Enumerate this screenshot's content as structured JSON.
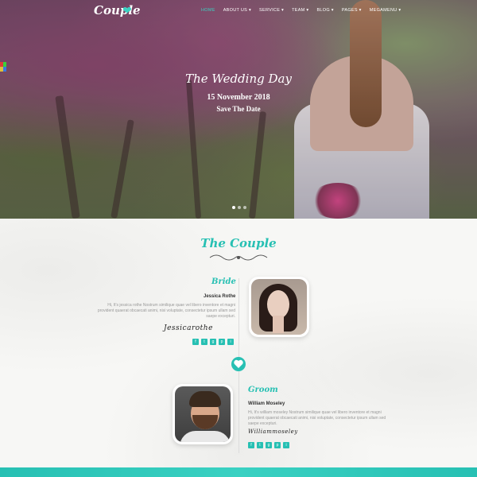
{
  "site": {
    "logo": "Couple"
  },
  "nav": {
    "items": [
      "HOME",
      "ABOUT US ▾",
      "SERVICE ▾",
      "TEAM ▾",
      "BLOG ▾",
      "PAGES ▾",
      "MEGAMENU ▾"
    ],
    "active_index": 0
  },
  "hero": {
    "title": "The Wedding Day",
    "date": "15 November 2018",
    "tagline": "Save The Date",
    "slides": 3,
    "active_slide": 0
  },
  "couple": {
    "section_title": "The Couple",
    "bride": {
      "role": "Bride",
      "name": "Jessica Rothe",
      "bio": "Hi, It's jessica rothe Nostrum similique quae vel libero inventore et magni provident quaerat obcaecati animi, nisi voluptate, consectetur ipsum ullam sed saepe excepturi.",
      "signature": "Jessicarothe"
    },
    "groom": {
      "role": "Groom",
      "name": "William Moseley",
      "bio": "Hi, It's william moseley Nostrum similique quae vel libero inventore et magni provident quaerat obcaecati animi, nisi voluptate, consectetur ipsum ullam sed saepe excepturi.",
      "signature": "Williammoseley"
    },
    "social_icons": [
      "f",
      "t",
      "g",
      "p",
      "i"
    ]
  },
  "colors": {
    "accent": "#27c0b3"
  }
}
